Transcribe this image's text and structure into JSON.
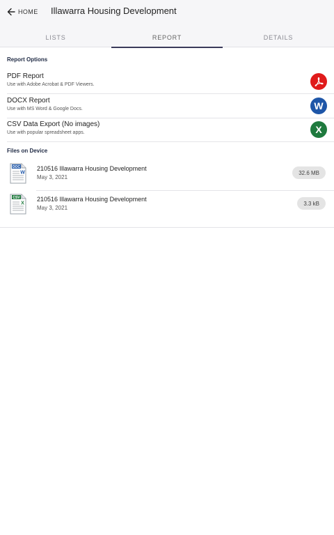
{
  "header": {
    "back_label": "HOME",
    "title": "Illawarra Housing Development"
  },
  "tabs": [
    {
      "label": "LISTS"
    },
    {
      "label": "REPORT"
    },
    {
      "label": "DETAILS"
    }
  ],
  "report_options": {
    "section_title": "Report Options",
    "items": [
      {
        "title": "PDF Report",
        "subtitle": "Use with Adobe Acrobat & PDF Viewers.",
        "icon": "pdf-icon",
        "color": "#e01b1b"
      },
      {
        "title": "DOCX Report",
        "subtitle": "Use with MS Word & Google Docs.",
        "icon": "word-icon",
        "glyph": "W",
        "color": "#1e56a8"
      },
      {
        "title": "CSV Data Export (No images)",
        "subtitle": "Use with popular spreadsheet apps.",
        "icon": "excel-icon",
        "glyph": "X",
        "color": "#1f7a3e"
      }
    ]
  },
  "files": {
    "section_title": "Files on Device",
    "items": [
      {
        "name": "210516 Illawarra Housing Development",
        "date": "May 3, 2021",
        "size": "32.6 MB",
        "type_badge": "DOC",
        "type_letter": "W",
        "icon": "doc-file-icon"
      },
      {
        "name": "210516 Illawarra Housing Development",
        "date": "May 3, 2021",
        "size": "3.3 kB",
        "type_badge": "CSV",
        "type_letter": "X",
        "icon": "csv-file-icon"
      }
    ]
  }
}
